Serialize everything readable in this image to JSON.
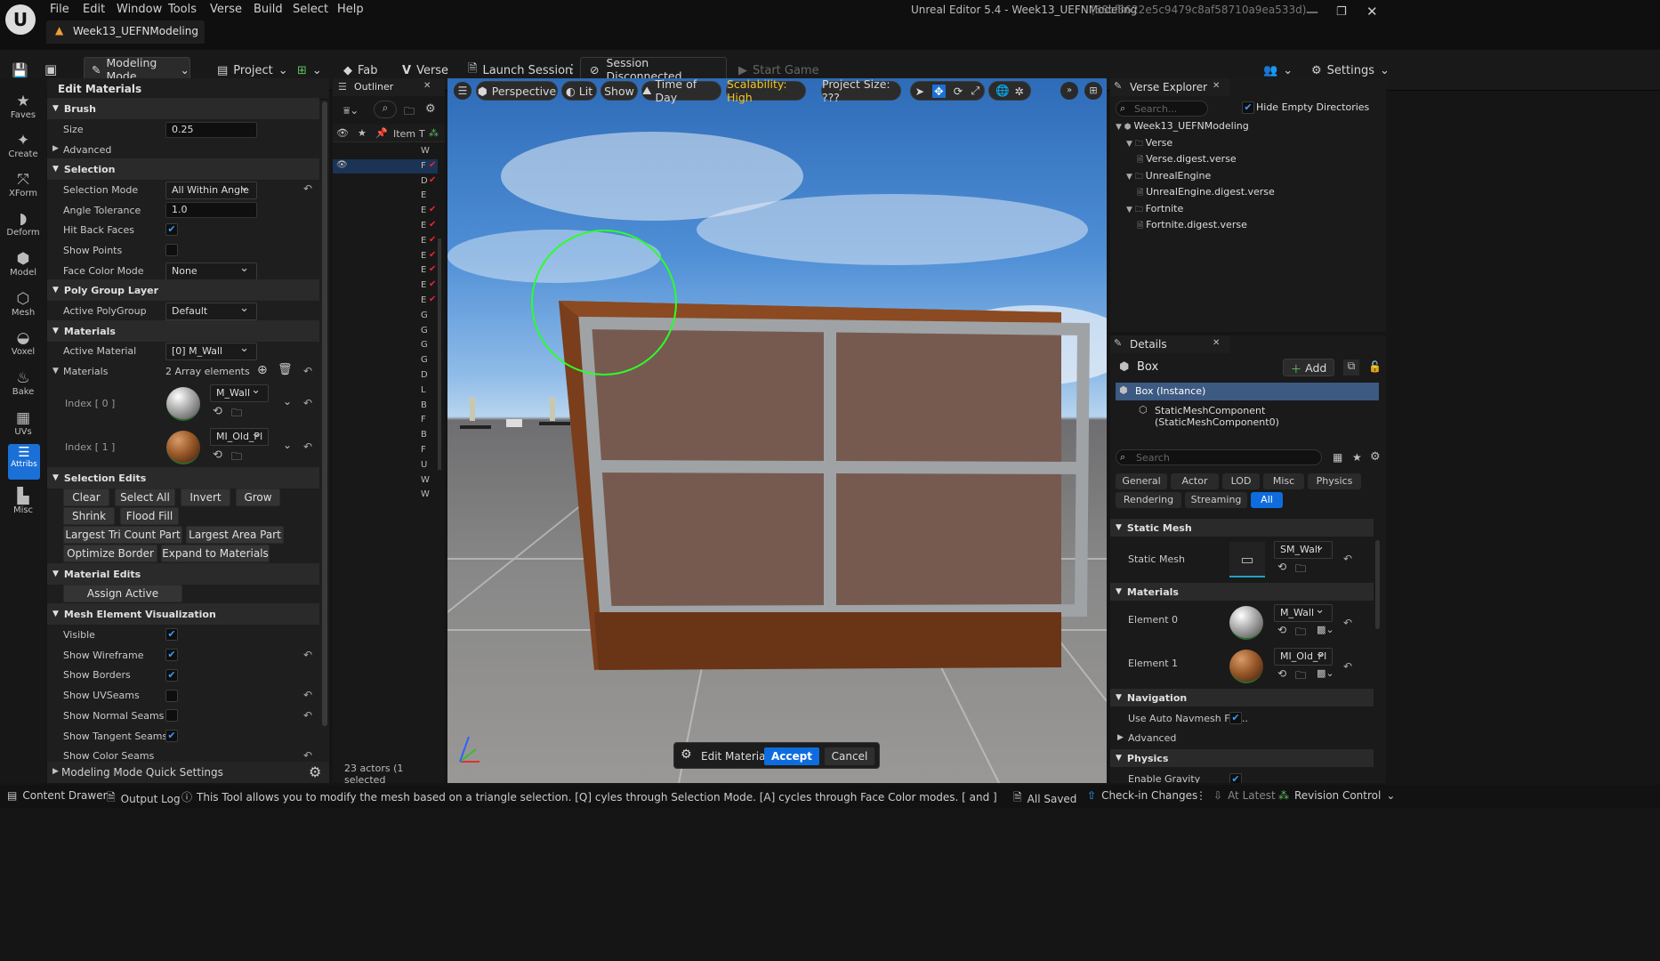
{
  "app": {
    "logo": "unreal-logo",
    "window_title": "Unreal Editor 5.4 - Week13_UEFNModeling",
    "window_id": "(68cf3622e5c9479c8af58710a9ea533d)",
    "project_tab": "Week13_UEFNModeling",
    "menu": [
      "File",
      "Edit",
      "Window",
      "Tools",
      "Verse",
      "Build",
      "Select",
      "Help"
    ]
  },
  "toolbar": {
    "mode": "Modeling Mode",
    "project": "Project",
    "fab": "Fab",
    "verse": "Verse",
    "launch_session": "Launch Session",
    "session_status": "Session Disconnected",
    "start_game": "Start Game",
    "settings": "Settings"
  },
  "mode_palette": [
    "Faves",
    "Create",
    "XForm",
    "Deform",
    "Model",
    "Mesh",
    "Voxel",
    "Bake",
    "UVs",
    "Attribs",
    "Misc"
  ],
  "tool_panel": {
    "title": "Edit Materials",
    "brush": {
      "header": "Brush",
      "size_label": "Size",
      "size_value": "0.25",
      "advanced": "Advanced"
    },
    "selection": {
      "header": "Selection",
      "mode_label": "Selection Mode",
      "mode_value": "All Within Angle",
      "angle_label": "Angle Tolerance",
      "angle_value": "1.0",
      "hit_back_label": "Hit Back Faces",
      "show_points_label": "Show Points",
      "face_color_label": "Face Color Mode",
      "face_color_value": "None"
    },
    "polygroup": {
      "header": "Poly Group Layer",
      "active_label": "Active PolyGroup",
      "active_value": "Default"
    },
    "materials": {
      "header": "Materials",
      "active_label": "Active Material",
      "active_value": "[0] M_Wall",
      "list_label": "Materials",
      "list_count": "2 Array elements",
      "index0_label": "Index [ 0 ]",
      "index0_value": "M_Wall",
      "index1_label": "Index [ 1 ]",
      "index1_value": "MI_Old_Pl"
    },
    "selection_edits": {
      "header": "Selection Edits",
      "clear": "Clear",
      "select_all": "Select All",
      "invert": "Invert",
      "grow": "Grow",
      "shrink": "Shrink",
      "flood_fill": "Flood Fill",
      "largest_tri": "Largest Tri Count Part",
      "largest_area": "Largest Area Part",
      "optimize": "Optimize Border",
      "expand": "Expand to Materials"
    },
    "material_edits": {
      "header": "Material Edits",
      "assign": "Assign Active Material"
    },
    "visualization": {
      "header": "Mesh Element Visualization",
      "visible": "Visible",
      "wireframe": "Show Wireframe",
      "borders": "Show Borders",
      "uvseams": "Show UVSeams",
      "normal_seams": "Show Normal Seams",
      "tangent_seams": "Show Tangent Seams",
      "color_seams": "Show Color Seams"
    },
    "quick_settings": "Modeling Mode Quick Settings"
  },
  "outliner": {
    "title": "Outliner",
    "col_item": "Item",
    "col_type": "T",
    "rows": [
      "W",
      "F",
      "D",
      "E",
      "E",
      "E",
      "E",
      "E",
      "E",
      "E",
      "E",
      "G",
      "G",
      "G",
      "G",
      "D",
      "L",
      "B",
      "F",
      "B",
      "F",
      "U",
      "W",
      "W"
    ],
    "footer": "23 actors (1 selected"
  },
  "viewport": {
    "perspective": "Perspective",
    "lit": "Lit",
    "show": "Show",
    "time_of_day": "Time of Day",
    "scalability": "Scalability: High",
    "project_size": "Project Size: ???",
    "tool_name": "Edit Materials",
    "accept": "Accept",
    "cancel": "Cancel"
  },
  "verse_explorer": {
    "title": "Verse Explorer",
    "search_placeholder": "Search...",
    "hide_empty": "Hide Empty Directories",
    "tree": [
      {
        "label": "Week13_UEFNModeling",
        "level": 0
      },
      {
        "label": "Verse",
        "level": 1
      },
      {
        "label": "Verse.digest.verse",
        "level": 2
      },
      {
        "label": "UnrealEngine",
        "level": 1
      },
      {
        "label": "UnrealEngine.digest.verse",
        "level": 2
      },
      {
        "label": "Fortnite",
        "level": 1
      },
      {
        "label": "Fortnite.digest.verse",
        "level": 2
      }
    ]
  },
  "details": {
    "title": "Details",
    "actor": "Box",
    "add": "Add",
    "instance": "Box (Instance)",
    "component": "StaticMeshComponent (StaticMeshComponent0)",
    "search_placeholder": "Search",
    "filters_row1": [
      "General",
      "Actor",
      "LOD",
      "Misc",
      "Physics"
    ],
    "filters_row2": [
      "Rendering",
      "Streaming",
      "All"
    ],
    "static_mesh_header": "Static Mesh",
    "static_mesh_label": "Static Mesh",
    "static_mesh_value": "SM_Wall",
    "materials_header": "Materials",
    "element0_label": "Element 0",
    "element0_value": "M_Wall",
    "element1_label": "Element 1",
    "element1_value": "MI_Old_Pl",
    "navigation_header": "Navigation",
    "navmesh_label": "Use Auto Navmesh Fla...",
    "advanced": "Advanced",
    "physics_header": "Physics",
    "gravity_label": "Enable Gravity"
  },
  "statusbar": {
    "content_drawer": "Content Drawer",
    "output_log": "Output Log",
    "hint": "This Tool allows you to modify the mesh based on a triangle selection. [Q] cyles through Selection Mode. [A] cycles through Face Color modes. [ and ] change brush size, < and > grow/shrin",
    "all_saved": "All Saved",
    "checkin": "Check-in Changes",
    "at_latest": "At Latest",
    "revision": "Revision Control"
  },
  "colors": {
    "accent": "#0e6cde",
    "scalability": "#f3c623",
    "brush_ring": "#2bff2b"
  }
}
